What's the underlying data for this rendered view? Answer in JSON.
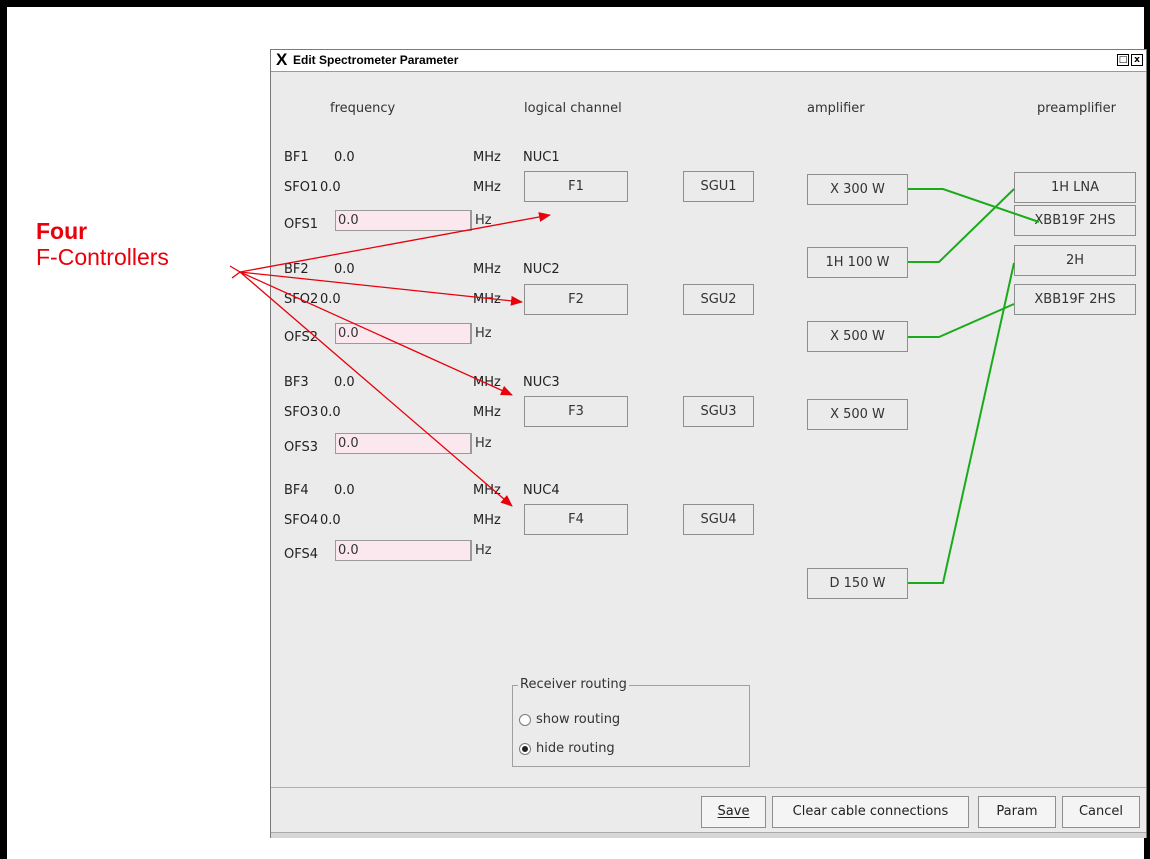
{
  "annotation": {
    "title": "Four",
    "subtitle": "F-Controllers",
    "color": "#e8000b"
  },
  "window": {
    "title": "Edit Spectrometer Parameter",
    "logo": "X",
    "restore_icon": "□",
    "close_icon": "x"
  },
  "headers": {
    "frequency": "frequency",
    "logical": "logical channel",
    "amplifier": "amplifier",
    "preamplifier": "preamplifier"
  },
  "channels": [
    {
      "bf_label": "BF1",
      "bf_value": "0.0",
      "bf_unit": "MHz",
      "nuc": "NUC1",
      "sfo_label": "SFO1",
      "sfo_value": "0.0",
      "sfo_unit": "MHz",
      "ofs_label": "OFS1",
      "ofs_value": "0.0",
      "ofs_unit": "Hz",
      "f": "F1",
      "sgu": "SGU1"
    },
    {
      "bf_label": "BF2",
      "bf_value": "0.0",
      "bf_unit": "MHz",
      "nuc": "NUC2",
      "sfo_label": "SFO2",
      "sfo_value": "0.0",
      "sfo_unit": "MHz",
      "ofs_label": "OFS2",
      "ofs_value": "0.0",
      "ofs_unit": "Hz",
      "f": "F2",
      "sgu": "SGU2"
    },
    {
      "bf_label": "BF3",
      "bf_value": "0.0",
      "bf_unit": "MHz",
      "nuc": "NUC3",
      "sfo_label": "SFO3",
      "sfo_value": "0.0",
      "sfo_unit": "MHz",
      "ofs_label": "OFS3",
      "ofs_value": "0.0",
      "ofs_unit": "Hz",
      "f": "F3",
      "sgu": "SGU3"
    },
    {
      "bf_label": "BF4",
      "bf_value": "0.0",
      "bf_unit": "MHz",
      "nuc": "NUC4",
      "sfo_label": "SFO4",
      "sfo_value": "0.0",
      "sfo_unit": "MHz",
      "ofs_label": "OFS4",
      "ofs_value": "0.0",
      "ofs_unit": "Hz",
      "f": "F4",
      "sgu": "SGU4"
    }
  ],
  "amplifiers": [
    "X 300 W",
    "1H 100 W",
    "X 500 W",
    "X 500 W",
    "D 150 W"
  ],
  "preamplifiers": [
    "1H LNA",
    "XBB19F 2HS",
    "2H",
    "XBB19F 2HS"
  ],
  "cable_color": "#1aab1a",
  "receiver_routing": {
    "title": "Receiver routing",
    "options": [
      "show routing",
      "hide routing"
    ],
    "selected": "hide routing"
  },
  "buttons": {
    "save": "Save",
    "clear": "Clear cable connections",
    "param": "Param",
    "cancel": "Cancel"
  }
}
